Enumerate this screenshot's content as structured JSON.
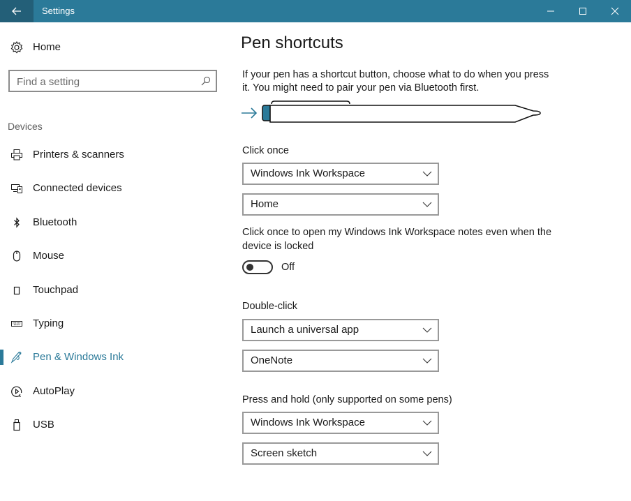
{
  "window": {
    "title": "Settings",
    "controls": {
      "back": "back-arrow-icon",
      "minimize": "minimize-icon",
      "maximize": "maximize-icon",
      "close": "close-icon"
    }
  },
  "sidebar": {
    "home_label": "Home",
    "search_placeholder": "Find a setting",
    "search_value": "",
    "section_label": "Devices",
    "items": [
      {
        "label": "Printers & scanners",
        "icon": "printer-icon",
        "active": false
      },
      {
        "label": "Connected devices",
        "icon": "connected-devices-icon",
        "active": false
      },
      {
        "label": "Bluetooth",
        "icon": "bluetooth-icon",
        "active": false
      },
      {
        "label": "Mouse",
        "icon": "mouse-icon",
        "active": false
      },
      {
        "label": "Touchpad",
        "icon": "touchpad-icon",
        "active": false
      },
      {
        "label": "Typing",
        "icon": "keyboard-icon",
        "active": false
      },
      {
        "label": "Pen & Windows Ink",
        "icon": "pen-icon",
        "active": true
      },
      {
        "label": "AutoPlay",
        "icon": "autoplay-icon",
        "active": false
      },
      {
        "label": "USB",
        "icon": "usb-icon",
        "active": false
      }
    ]
  },
  "main": {
    "title": "Pen shortcuts",
    "description": "If your pen has a shortcut button, choose what to do when you press it. You might need to pair your pen via Bluetooth first.",
    "click_once": {
      "label": "Click once",
      "action": "Windows Ink Workspace",
      "target": "Home"
    },
    "lock_note": "Click once to open my Windows Ink Workspace notes even when the device is locked",
    "lock_toggle": {
      "state": "Off",
      "on": false
    },
    "double_click": {
      "label": "Double-click",
      "action": "Launch a universal app",
      "target": "OneNote"
    },
    "press_hold": {
      "label": "Press and hold (only supported on some pens)",
      "action": "Windows Ink Workspace",
      "target": "Screen sketch"
    }
  },
  "colors": {
    "accent": "#2b7a99",
    "accent_dark": "#235f78"
  }
}
